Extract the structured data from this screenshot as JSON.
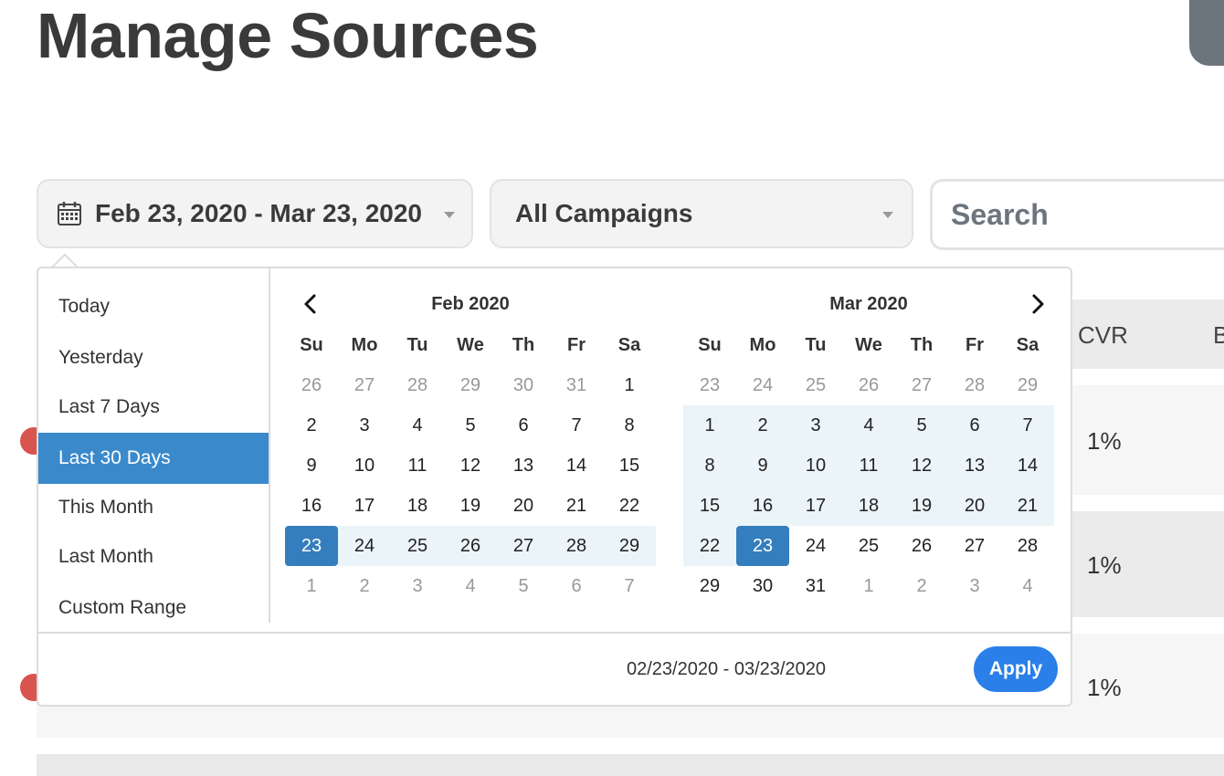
{
  "page": {
    "title": "Manage Sources"
  },
  "filters": {
    "date_range": "Feb 23, 2020 - Mar 23, 2020",
    "campaign": "All Campaigns",
    "search_placeholder": "Search"
  },
  "table": {
    "columns": [
      "CVR",
      "B"
    ],
    "rows": [
      {
        "cvr": "1%"
      },
      {
        "cvr": "1%"
      },
      {
        "cvr": "1%"
      }
    ]
  },
  "picker": {
    "ranges": [
      "Today",
      "Yesterday",
      "Last 7 Days",
      "Last 30 Days",
      "This Month",
      "Last Month",
      "Custom Range"
    ],
    "active_range": "Last 30 Days",
    "weekdays": [
      "Su",
      "Mo",
      "Tu",
      "We",
      "Th",
      "Fr",
      "Sa"
    ],
    "months": [
      {
        "title": "Feb 2020",
        "weeks": [
          [
            {
              "d": "26",
              "s": "off"
            },
            {
              "d": "27",
              "s": "off"
            },
            {
              "d": "28",
              "s": "off"
            },
            {
              "d": "29",
              "s": "off"
            },
            {
              "d": "30",
              "s": "off"
            },
            {
              "d": "31",
              "s": "off"
            },
            {
              "d": "1",
              "s": ""
            }
          ],
          [
            {
              "d": "2",
              "s": ""
            },
            {
              "d": "3",
              "s": ""
            },
            {
              "d": "4",
              "s": ""
            },
            {
              "d": "5",
              "s": ""
            },
            {
              "d": "6",
              "s": ""
            },
            {
              "d": "7",
              "s": ""
            },
            {
              "d": "8",
              "s": ""
            }
          ],
          [
            {
              "d": "9",
              "s": ""
            },
            {
              "d": "10",
              "s": ""
            },
            {
              "d": "11",
              "s": ""
            },
            {
              "d": "12",
              "s": ""
            },
            {
              "d": "13",
              "s": ""
            },
            {
              "d": "14",
              "s": ""
            },
            {
              "d": "15",
              "s": ""
            }
          ],
          [
            {
              "d": "16",
              "s": ""
            },
            {
              "d": "17",
              "s": ""
            },
            {
              "d": "18",
              "s": ""
            },
            {
              "d": "19",
              "s": ""
            },
            {
              "d": "20",
              "s": ""
            },
            {
              "d": "21",
              "s": ""
            },
            {
              "d": "22",
              "s": ""
            }
          ],
          [
            {
              "d": "23",
              "s": "start"
            },
            {
              "d": "24",
              "s": "in-range"
            },
            {
              "d": "25",
              "s": "in-range"
            },
            {
              "d": "26",
              "s": "in-range"
            },
            {
              "d": "27",
              "s": "in-range"
            },
            {
              "d": "28",
              "s": "in-range"
            },
            {
              "d": "29",
              "s": "in-range"
            }
          ],
          [
            {
              "d": "1",
              "s": "off"
            },
            {
              "d": "2",
              "s": "off"
            },
            {
              "d": "3",
              "s": "off"
            },
            {
              "d": "4",
              "s": "off"
            },
            {
              "d": "5",
              "s": "off"
            },
            {
              "d": "6",
              "s": "off"
            },
            {
              "d": "7",
              "s": "off"
            }
          ]
        ]
      },
      {
        "title": "Mar 2020",
        "weeks": [
          [
            {
              "d": "23",
              "s": "off"
            },
            {
              "d": "24",
              "s": "off"
            },
            {
              "d": "25",
              "s": "off"
            },
            {
              "d": "26",
              "s": "off"
            },
            {
              "d": "27",
              "s": "off"
            },
            {
              "d": "28",
              "s": "off"
            },
            {
              "d": "29",
              "s": "off"
            }
          ],
          [
            {
              "d": "1",
              "s": "in-range"
            },
            {
              "d": "2",
              "s": "in-range"
            },
            {
              "d": "3",
              "s": "in-range"
            },
            {
              "d": "4",
              "s": "in-range"
            },
            {
              "d": "5",
              "s": "in-range"
            },
            {
              "d": "6",
              "s": "in-range"
            },
            {
              "d": "7",
              "s": "in-range"
            }
          ],
          [
            {
              "d": "8",
              "s": "in-range"
            },
            {
              "d": "9",
              "s": "in-range"
            },
            {
              "d": "10",
              "s": "in-range"
            },
            {
              "d": "11",
              "s": "in-range"
            },
            {
              "d": "12",
              "s": "in-range"
            },
            {
              "d": "13",
              "s": "in-range"
            },
            {
              "d": "14",
              "s": "in-range"
            }
          ],
          [
            {
              "d": "15",
              "s": "in-range"
            },
            {
              "d": "16",
              "s": "in-range"
            },
            {
              "d": "17",
              "s": "in-range"
            },
            {
              "d": "18",
              "s": "in-range"
            },
            {
              "d": "19",
              "s": "in-range"
            },
            {
              "d": "20",
              "s": "in-range"
            },
            {
              "d": "21",
              "s": "in-range"
            }
          ],
          [
            {
              "d": "22",
              "s": "in-range"
            },
            {
              "d": "23",
              "s": "end"
            },
            {
              "d": "24",
              "s": ""
            },
            {
              "d": "25",
              "s": ""
            },
            {
              "d": "26",
              "s": ""
            },
            {
              "d": "27",
              "s": ""
            },
            {
              "d": "28",
              "s": ""
            }
          ],
          [
            {
              "d": "29",
              "s": ""
            },
            {
              "d": "30",
              "s": ""
            },
            {
              "d": "31",
              "s": ""
            },
            {
              "d": "1",
              "s": "off"
            },
            {
              "d": "2",
              "s": "off"
            },
            {
              "d": "3",
              "s": "off"
            },
            {
              "d": "4",
              "s": "off"
            }
          ]
        ]
      }
    ],
    "selected_range_text": "02/23/2020 - 03/23/2020",
    "apply_label": "Apply"
  },
  "icons": {
    "date": "calendar-icon",
    "prev": "chevron-left-icon",
    "next": "chevron-right-icon"
  },
  "colors": {
    "accent": "#3a8acb",
    "selected_day": "#357ebd",
    "in_range": "#ebf4f8",
    "apply": "#2a7fe8",
    "warning": "#d9534f"
  }
}
